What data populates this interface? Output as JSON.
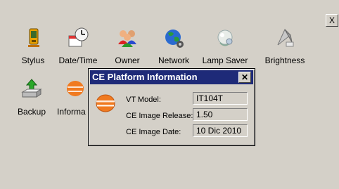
{
  "control_panel": {
    "close_label": "X",
    "icons": [
      {
        "name": "stylus-icon",
        "label": "Stylus"
      },
      {
        "name": "date-time-icon",
        "label": "Date/Time"
      },
      {
        "name": "owner-icon",
        "label": "Owner"
      },
      {
        "name": "network-icon",
        "label": "Network"
      },
      {
        "name": "lamp-saver-icon",
        "label": "Lamp Saver"
      },
      {
        "name": "brightness-icon",
        "label": "Brightness"
      },
      {
        "name": "backup-icon",
        "label": "Backup"
      },
      {
        "name": "information-icon",
        "label": "Informa"
      }
    ]
  },
  "dialog": {
    "title": "CE Platform Information",
    "close_label": "✕",
    "rows": [
      {
        "label": "VT Model:",
        "value": "IT104T"
      },
      {
        "label": "CE Image Release:",
        "value": "1.50"
      },
      {
        "label": "CE Image Date:",
        "value": "10 Dic 2010"
      }
    ]
  }
}
